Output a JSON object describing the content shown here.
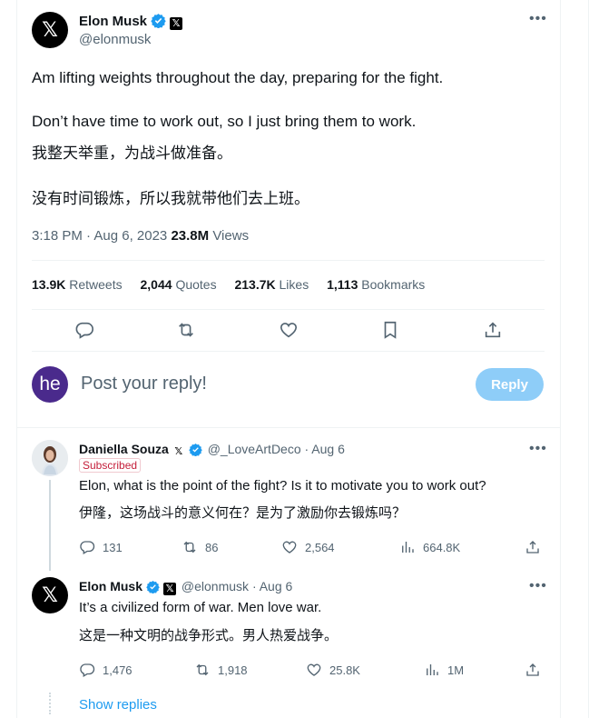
{
  "main_tweet": {
    "author_name": "Elon Musk",
    "author_handle": "@elonmusk",
    "lines": [
      "Am lifting weights throughout the day, preparing for the fight.",
      "Don’t have time to work out, so I just bring them to work.",
      "我整天举重，为战斗做准备。",
      "没有时间锻炼，所以我就带他们去上班。"
    ],
    "time": "3:18 PM · Aug 6, 2023",
    "views_count": "23.8M",
    "views_label": "Views",
    "stats": {
      "retweets_count": "13.9K",
      "retweets_label": "Retweets",
      "quotes_count": "2,044",
      "quotes_label": "Quotes",
      "likes_count": "213.7K",
      "likes_label": "Likes",
      "bookmarks_count": "1,113",
      "bookmarks_label": "Bookmarks"
    }
  },
  "composer": {
    "avatar_initials": "he",
    "placeholder": "Post your reply!",
    "reply_button": "Reply"
  },
  "replies": [
    {
      "author_name": "Daniella Souza",
      "author_handle": "@_LoveArtDeco",
      "date": "· Aug 6",
      "badge": "Subscribed",
      "text_en": "Elon, what is the point of the fight? Is it to motivate you to work out?",
      "text_zh": "伊隆，这场战斗的意义何在？是为了激励你去锻炼吗？",
      "replies": "131",
      "retweets": "86",
      "likes": "2,564",
      "views": "664.8K"
    },
    {
      "author_name": "Elon Musk",
      "author_handle": "@elonmusk",
      "date": "· Aug 6",
      "text_en": "It’s a civilized form of war. Men love war.",
      "text_zh": "这是一种文明的战争形式。男人热爱战争。",
      "replies": "1,476",
      "retweets": "1,918",
      "likes": "25.8K",
      "views": "1M"
    }
  ],
  "show_replies": "Show replies",
  "colors": {
    "accent": "#1d9bf0",
    "verified": "#1d9bf0",
    "composer_avatar": "#4a2a8c",
    "reply_disabled": "#8ecdf8"
  }
}
